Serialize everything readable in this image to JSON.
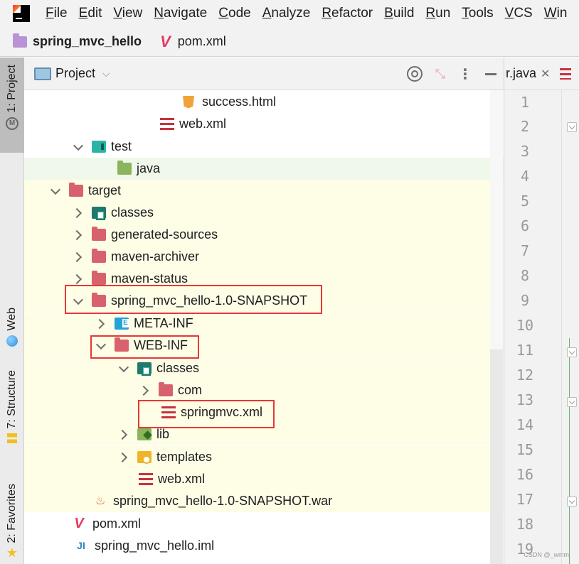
{
  "menubar": {
    "items": [
      "File",
      "Edit",
      "View",
      "Navigate",
      "Code",
      "Analyze",
      "Refactor",
      "Build",
      "Run",
      "Tools",
      "VCS",
      "Win"
    ]
  },
  "navbar": {
    "project": "spring_mvc_hello",
    "file": "pom.xml"
  },
  "toolstrip": {
    "project_tab": "1: Project",
    "web_tab": "Web",
    "structure_tab": "7: Structure",
    "favorites_tab": "2: Favorites"
  },
  "project_panel": {
    "title": "Project",
    "tree": [
      {
        "label": "success.html",
        "type": "html",
        "expanded": null
      },
      {
        "label": "web.xml",
        "type": "xml",
        "expanded": null
      },
      {
        "label": "test",
        "type": "folder-teal",
        "expanded": true
      },
      {
        "label": "java",
        "type": "folder-green",
        "expanded": null
      },
      {
        "label": "target",
        "type": "folder-red",
        "expanded": true
      },
      {
        "label": "classes",
        "type": "folder-classes",
        "expanded": false
      },
      {
        "label": "generated-sources",
        "type": "folder-red",
        "expanded": false
      },
      {
        "label": "maven-archiver",
        "type": "folder-red",
        "expanded": false
      },
      {
        "label": "maven-status",
        "type": "folder-red",
        "expanded": false
      },
      {
        "label": "spring_mvc_hello-1.0-SNAPSHOT",
        "type": "folder-red",
        "expanded": true,
        "highlighted": true
      },
      {
        "label": "META-INF",
        "type": "folder-meta",
        "expanded": false
      },
      {
        "label": "WEB-INF",
        "type": "folder-red",
        "expanded": true,
        "highlighted": true
      },
      {
        "label": "classes",
        "type": "folder-classes",
        "expanded": true
      },
      {
        "label": "com",
        "type": "folder-red",
        "expanded": false
      },
      {
        "label": "springmvc.xml",
        "type": "xml",
        "expanded": null,
        "highlighted": true
      },
      {
        "label": "lib",
        "type": "folder-lib",
        "expanded": false
      },
      {
        "label": "templates",
        "type": "folder-tpl",
        "expanded": false
      },
      {
        "label": "web.xml",
        "type": "xml",
        "expanded": null
      },
      {
        "label": "spring_mvc_hello-1.0-SNAPSHOT.war",
        "type": "war",
        "expanded": null
      },
      {
        "label": "pom.xml",
        "type": "pom",
        "expanded": null
      },
      {
        "label": "spring_mvc_hello.iml",
        "type": "iml",
        "expanded": null
      }
    ]
  },
  "editor": {
    "tab_title": "r.java",
    "line_numbers": [
      "1",
      "2",
      "3",
      "4",
      "5",
      "6",
      "7",
      "8",
      "9",
      "10",
      "11",
      "12",
      "13",
      "14",
      "15",
      "16",
      "17",
      "18",
      "19"
    ]
  },
  "watermark": "CSDN @_wmm",
  "colors": {
    "highlight_box": "#e53935",
    "target_folder": "#d8616e",
    "excluded_background": "#fefde6",
    "test_background": "#eff8ea"
  }
}
